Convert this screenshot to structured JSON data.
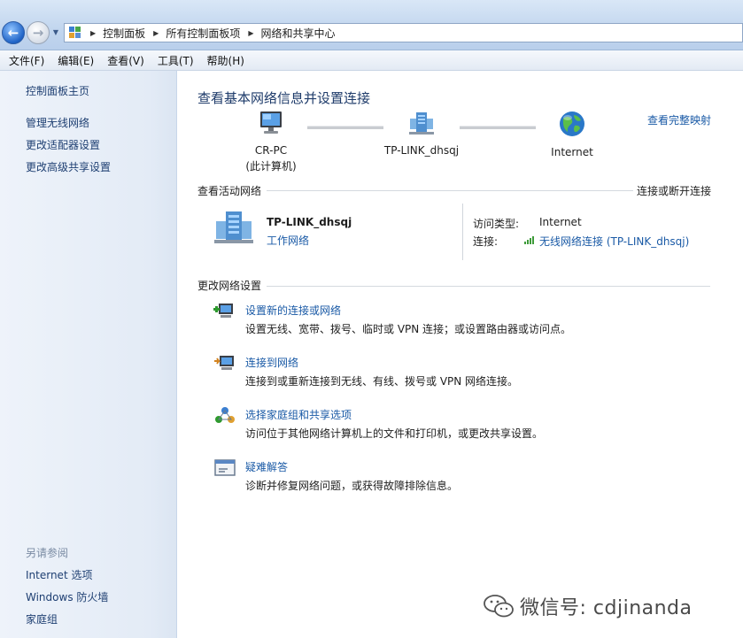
{
  "address_bar": {
    "breadcrumbs": [
      "控制面板",
      "所有控制面板项",
      "网络和共享中心"
    ]
  },
  "menu": [
    "文件(F)",
    "编辑(E)",
    "查看(V)",
    "工具(T)",
    "帮助(H)"
  ],
  "sidebar": {
    "links": [
      "控制面板主页",
      "管理无线网络",
      "更改适配器设置",
      "更改高级共享设置"
    ],
    "see_also_heading": "另请参阅",
    "see_also": [
      "Internet 选项",
      "Windows 防火墙",
      "家庭组"
    ]
  },
  "main": {
    "title": "查看基本网络信息并设置连接",
    "full_map_link": "查看完整映射",
    "map": {
      "computer_name": "CR-PC",
      "computer_sub": "(此计算机)",
      "network": "TP-LINK_dhsqj",
      "internet": "Internet"
    },
    "active_networks": {
      "heading": "查看活动网络",
      "connect_link": "连接或断开连接",
      "name": "TP-LINK_dhsqj",
      "type": "工作网络",
      "access_type_label": "访问类型:",
      "access_type_value": "Internet",
      "connection_label": "连接:",
      "connection_value": "无线网络连接 (TP-LINK_dhsqj)"
    },
    "change_settings": {
      "heading": "更改网络设置",
      "tasks": [
        {
          "title": "设置新的连接或网络",
          "desc": "设置无线、宽带、拨号、临时或 VPN 连接；或设置路由器或访问点。"
        },
        {
          "title": "连接到网络",
          "desc": "连接到或重新连接到无线、有线、拨号或 VPN 网络连接。"
        },
        {
          "title": "选择家庭组和共享选项",
          "desc": "访问位于其他网络计算机上的文件和打印机，或更改共享设置。"
        },
        {
          "title": "疑难解答",
          "desc": "诊断并修复网络问题，或获得故障排除信息。"
        }
      ]
    }
  },
  "watermark": "微信号: cdjinanda",
  "colors": {
    "link": "#1a5aa6",
    "title": "#1e3b6a",
    "sidebar_link": "#1e3f72"
  }
}
